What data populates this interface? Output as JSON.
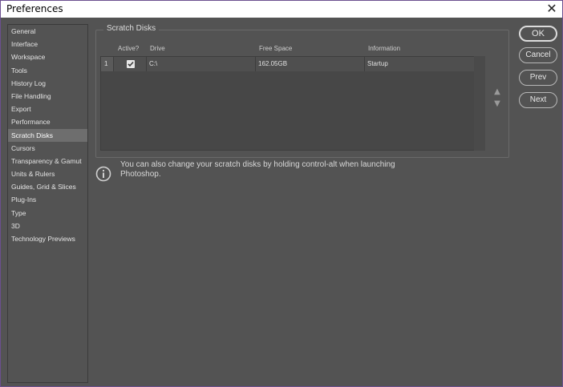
{
  "window": {
    "title": "Preferences",
    "close_glyph": "✕"
  },
  "sidebar": {
    "items": [
      {
        "label": "General"
      },
      {
        "label": "Interface"
      },
      {
        "label": "Workspace"
      },
      {
        "label": "Tools"
      },
      {
        "label": "History Log"
      },
      {
        "label": "File Handling"
      },
      {
        "label": "Export"
      },
      {
        "label": "Performance"
      },
      {
        "label": "Scratch Disks",
        "selected": true
      },
      {
        "label": "Cursors"
      },
      {
        "label": "Transparency & Gamut"
      },
      {
        "label": "Units & Rulers"
      },
      {
        "label": "Guides, Grid & Slices"
      },
      {
        "label": "Plug-Ins"
      },
      {
        "label": "Type"
      },
      {
        "label": "3D"
      },
      {
        "label": "Technology Previews"
      }
    ]
  },
  "scratch_disks": {
    "group_title": "Scratch Disks",
    "columns": {
      "active": "Active?",
      "drive": "Drive",
      "free_space": "Free Space",
      "information": "Information"
    },
    "rows": [
      {
        "index": "1",
        "active": true,
        "drive": "C:\\",
        "free_space": "162.05GB",
        "information": "Startup"
      }
    ],
    "move_up_glyph": "▲",
    "move_down_glyph": "▼"
  },
  "info": {
    "message": "You can also change your scratch disks by holding control-alt when launching Photoshop."
  },
  "buttons": {
    "ok": "OK",
    "cancel": "Cancel",
    "prev": "Prev",
    "next": "Next"
  },
  "colors": {
    "background": "#535353",
    "selected_item": "#6e6e6e",
    "window_border": "#6b4f8f"
  },
  "icons": {
    "close": "close-icon",
    "checkbox": "checkmark-icon",
    "info": "info-icon",
    "up": "arrow-up-icon",
    "down": "arrow-down-icon"
  }
}
